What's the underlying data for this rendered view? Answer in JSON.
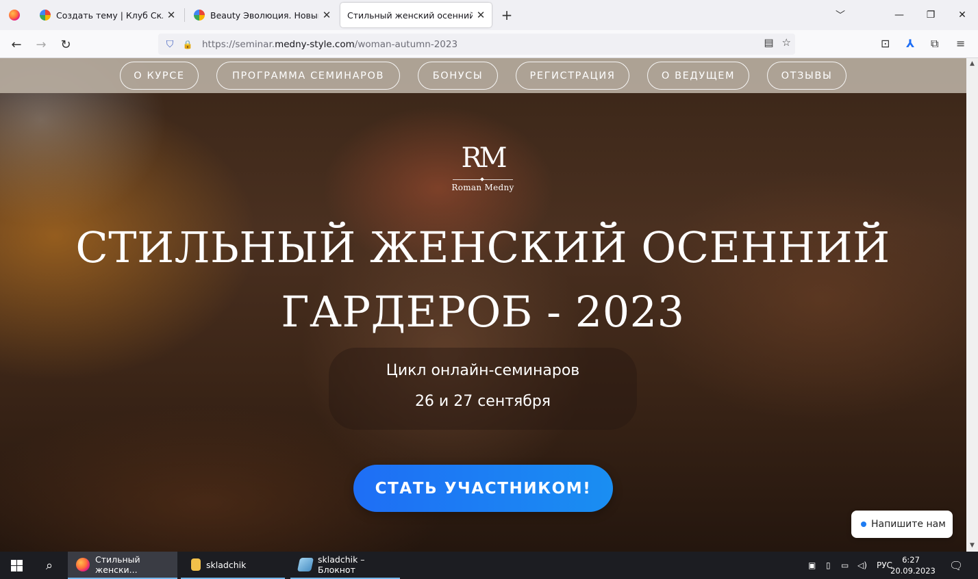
{
  "browser": {
    "tabs": [
      {
        "title": "Создать тему | Клуб Складчик"
      },
      {
        "title": "Beauty Эволюция. Новый опы"
      },
      {
        "title": "Стильный женский осенний гарде"
      }
    ],
    "new_tab_icon": "+",
    "list_all_icon": "﹀",
    "window_controls": {
      "minimize": "—",
      "maximize": "❐",
      "close": "✕"
    },
    "close_tab_icon": "✕",
    "nav": {
      "back_icon": "←",
      "forward_icon": "→",
      "reload_icon": "↻"
    },
    "url": {
      "prefix": "https://seminar.",
      "domain": "medny-style.com",
      "path": "/woman-autumn-2023"
    },
    "url_icons": {
      "shield": "⛉",
      "lock": "🔒",
      "reader": "▤",
      "bookmark": "☆"
    },
    "toolbar_icons": {
      "pocket": "⊡",
      "acrobat": "⅄",
      "extensions": "⧉",
      "menu": "≡"
    }
  },
  "site": {
    "nav": [
      "О КУРСЕ",
      "ПРОГРАММА СЕМИНАРОВ",
      "БОНУСЫ",
      "РЕГИСТРАЦИЯ",
      "О ВЕДУЩЕМ",
      "ОТЗЫВЫ"
    ],
    "logo": {
      "monogram": "RM",
      "name": "Roman Medny"
    },
    "title_line1": "СТИЛЬНЫЙ ЖЕНСКИЙ ОСЕННИЙ",
    "title_line2": "ГАРДЕРОБ - 2023",
    "subtitle": "Цикл онлайн-семинаров",
    "dates": "26 и 27 сентября",
    "cta": "СТАТЬ УЧАСТНИКОМ!",
    "chat": "Напишите нам",
    "accent_color": "#1e7cf2"
  },
  "taskbar": {
    "search_icon": "⌕",
    "apps": [
      {
        "label": "Стильный женски..."
      },
      {
        "label": "skladchik"
      },
      {
        "label": "skladchik – Блокнот"
      }
    ],
    "tray": {
      "lang": "РУС",
      "time": "6:27",
      "date": "20.09.2023",
      "notifications_icon": "🗨"
    }
  }
}
